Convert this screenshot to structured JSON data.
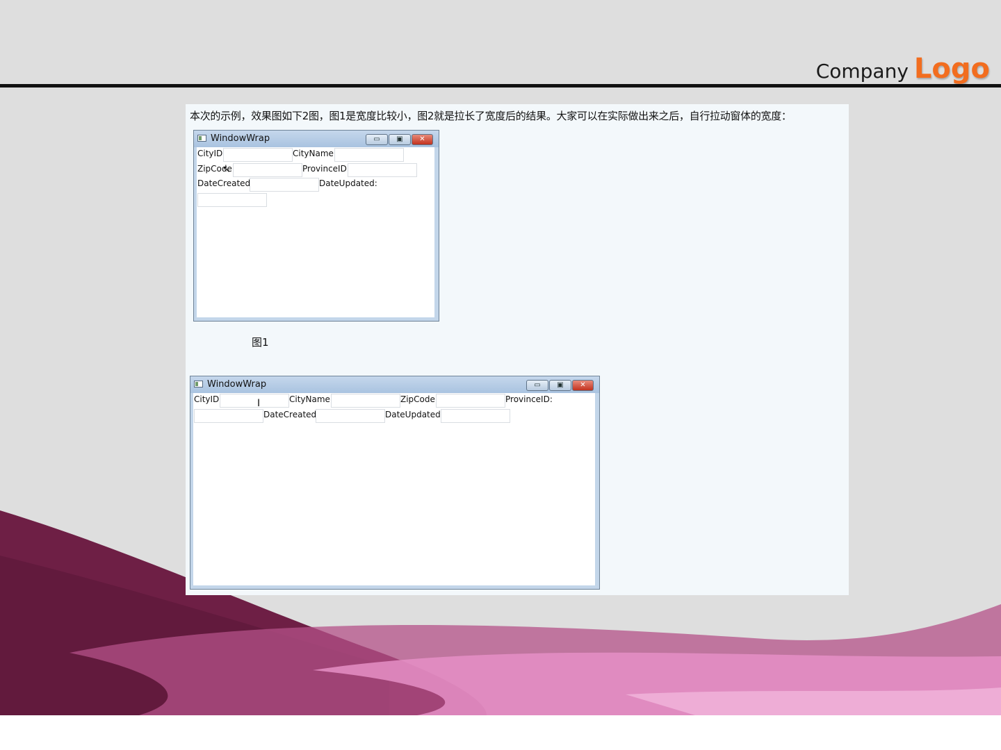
{
  "header": {
    "logo_company": "Company",
    "logo_logo": "Logo"
  },
  "caption": "本次的示例，效果图如下2图，图1是宽度比较小，图2就是拉长了宽度后的结果。大家可以在实际做出来之后，自行拉动窗体的宽度：",
  "figure1": {
    "label": "图1",
    "window_title": "WindowWrap",
    "buttons": {
      "minimize": "▭",
      "maximize": "▣",
      "close": "✕"
    },
    "labels": {
      "city_id": "CityID:",
      "city_name": "CityName:",
      "zip_code": "ZipCode:",
      "province_id": "ProvinceID:",
      "date_created": "DateCreated:",
      "date_updated": "DateUpdated:"
    }
  },
  "figure2": {
    "window_title": "WindowWrap",
    "buttons": {
      "minimize": "▭",
      "maximize": "▣",
      "close": "✕"
    },
    "labels": {
      "city_id": "CityID:",
      "city_name": "CityName:",
      "zip_code": "ZipCode:",
      "province_id": "ProvinceID:",
      "date_created": "DateCreated:",
      "date_updated": "DateUpdated:"
    }
  },
  "colors": {
    "logo_accent": "#f26d1f",
    "wave_dark": "#6e1f45",
    "wave_mid": "#b45288",
    "wave_light": "#e58fc6",
    "content_bg": "#f3f8fb"
  }
}
